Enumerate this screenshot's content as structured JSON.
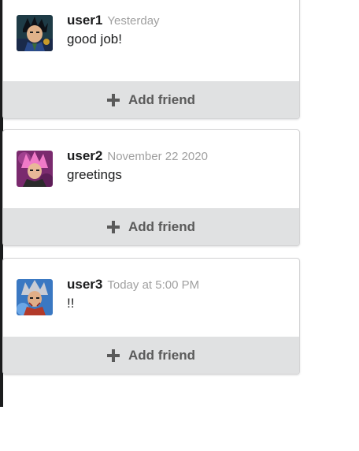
{
  "comments": [
    {
      "author": "user1",
      "date": "Yesterday",
      "text": "good job!",
      "avatar_icon": "avatar-dark-hair-icon",
      "action_label": "Add friend"
    },
    {
      "author": "user2",
      "date": "November 22 2020",
      "text": "greetings",
      "avatar_icon": "avatar-pink-hair-icon",
      "action_label": "Add friend"
    },
    {
      "author": "user3",
      "date": "Today at 5:00 PM",
      "text": "!!",
      "avatar_icon": "avatar-silver-hair-icon",
      "action_label": "Add friend"
    }
  ],
  "colors": {
    "button_bg": "#e0e1e2",
    "button_text": "#5a5a5a",
    "date_text": "#a0a0a0",
    "author_text": "#1b1c1d"
  }
}
